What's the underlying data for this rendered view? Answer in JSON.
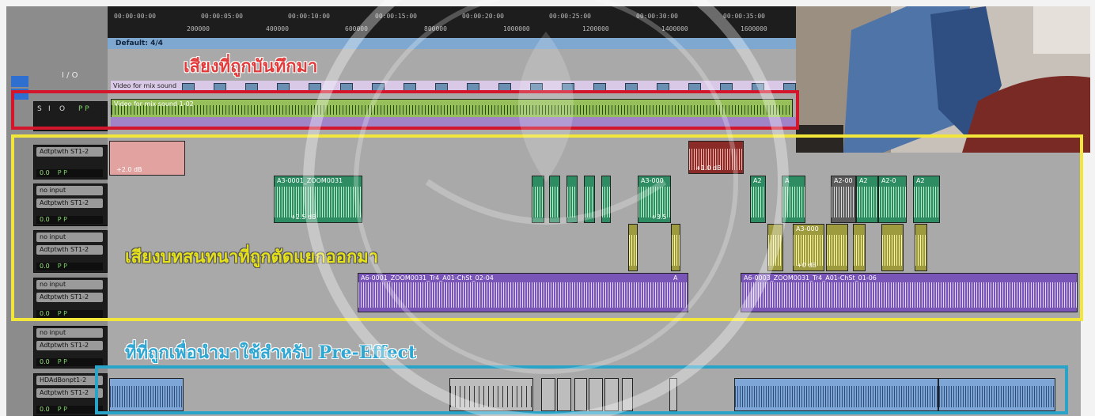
{
  "ruler": {
    "timecodes": [
      "00:00:00:00",
      "00:00:05:00",
      "00:00:10:00",
      "00:00:15:00",
      "00:00:20:00",
      "00:00:25:00",
      "00:00:30:00",
      "00:00:35:00"
    ],
    "samples": [
      "200000",
      "400000",
      "600000",
      "800000",
      "1000000",
      "1200000",
      "1400000",
      "1600000"
    ]
  },
  "tempo": {
    "label": "Default: 4/4"
  },
  "left_panel": {
    "io_label": "I / O",
    "record_track": {
      "buttons": [
        "S",
        "I",
        "O"
      ],
      "pp": "P P"
    },
    "tracks": [
      {
        "input": "",
        "output": "Adtptwth ST1-2",
        "value": "0.0",
        "pp": "P P"
      },
      {
        "input": "no input",
        "output": "Adtptwth ST1-2",
        "value": "0.0",
        "pp": "P P"
      },
      {
        "input": "no input",
        "output": "Adtptwth ST1-2",
        "value": "0.0",
        "pp": "P P"
      },
      {
        "input": "no input",
        "output": "Adtptwth ST1-2",
        "value": "0.0",
        "pp": "P P"
      },
      {
        "input": "no input",
        "output": "Adtptwth ST1-2",
        "value": "0.0",
        "pp": "P P"
      },
      {
        "input": "HDAdBonpt1-2",
        "output": "Adtptwth ST1-2",
        "value": "0.0",
        "pp": "P P"
      }
    ]
  },
  "clips": {
    "video_track": "Video for mix sound",
    "recorded": "Video for mix sound 1-02",
    "green_main": "A3-0001_ZOOM0031",
    "green_main_gain": "+2.5 dB",
    "green_a3": "A3-000",
    "green_a3_gain": "+3.5",
    "pink_gain": "+2.0 dB",
    "red_gain": "+1.0 dB",
    "small_a2": [
      "A2",
      "A",
      "A2-00",
      "A2",
      "A2-0",
      "A2"
    ],
    "yellow_a3": "A3-000",
    "yellow_gain": "+0 dB",
    "purple_1": "A6-0001_ZOOM0031_Tr4_A01-ChSt_02-04",
    "purple_1_tail": "A",
    "purple_2": "A6-0003_ZOOM0031_Tr4_A01-ChSt_01-06"
  },
  "annotations": {
    "recorded_label": "เสียงที่ถูกบันทึกมา",
    "dialogue_label": "เสียงบทสนทนาที่ถูกตัดแยกออกมา",
    "pre_effect_label": "ที่ที่ถูกเพื่อนำมาใช้สำหรับ Pre-Effect"
  },
  "colors": {
    "recorded_box": "#d4162c",
    "dialogue_box": "#f2e63a",
    "pre_effect_box": "#2aa3c9"
  }
}
